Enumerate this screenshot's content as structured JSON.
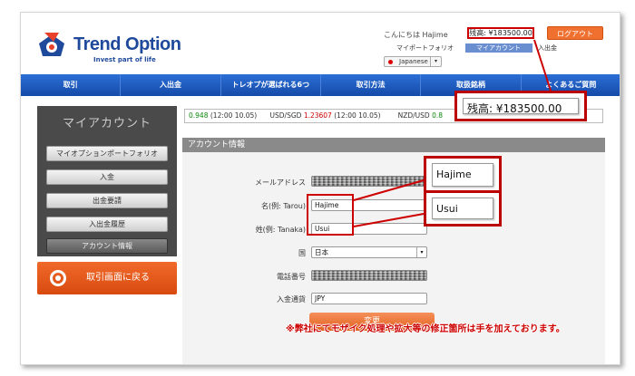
{
  "header": {
    "brand": "Trend Option",
    "tagline": "Invest part of life",
    "greeting": "こんにちは Hajime",
    "balance": "残高: ¥183500.00",
    "logout_label": "ログアウト",
    "links": {
      "portfolio": "マイポートフォリオ",
      "mypage": "マイアカウント",
      "deposit": "入出金"
    },
    "language": "Japanese"
  },
  "nav": {
    "items": [
      "取引",
      "入出金",
      "トレオプが選ばれる6つ",
      "取引方法",
      "取扱銘柄",
      "よくあるご質問"
    ]
  },
  "ticker": {
    "item1_value": "0.948",
    "item1_time": "(12:00 10.05)",
    "item2_pair": "USD/SGD",
    "item2_value": "1.23607",
    "item2_time": "(12:00 10.05)",
    "item3_pair": "NZD/USD",
    "item3_value": "0.8"
  },
  "sidebar": {
    "title": "マイアカウント",
    "items": [
      "マイオプションポートフォリオ",
      "入金",
      "出金要請",
      "入出金履歴",
      "アカウント情報"
    ],
    "back_label": "取引画面に戻る"
  },
  "account": {
    "panel_title": "アカウント情報",
    "email_label": "メールアドレス",
    "first_name_label": "名(例: Tarou)",
    "first_name_value": "Hajime",
    "last_name_label": "姓(例: Tanaka)",
    "last_name_value": "Usui",
    "country_label": "国",
    "country_value": "日本",
    "phone_label": "電話番号",
    "currency_label": "入金通貨",
    "currency_value": "JPY",
    "submit_label": "変更"
  },
  "callouts": {
    "balance": "残高: ¥183500.00",
    "first_name": "Hajime",
    "last_name": "Usui"
  },
  "note": "※弊社にてモザイク処理や拡大等の修正箇所は手を加えております。",
  "colors": {
    "nav_blue": "#1f5cc4",
    "accent_orange": "#e8662a",
    "highlight_red": "#c00000",
    "brand_blue": "#1f4a9c"
  }
}
